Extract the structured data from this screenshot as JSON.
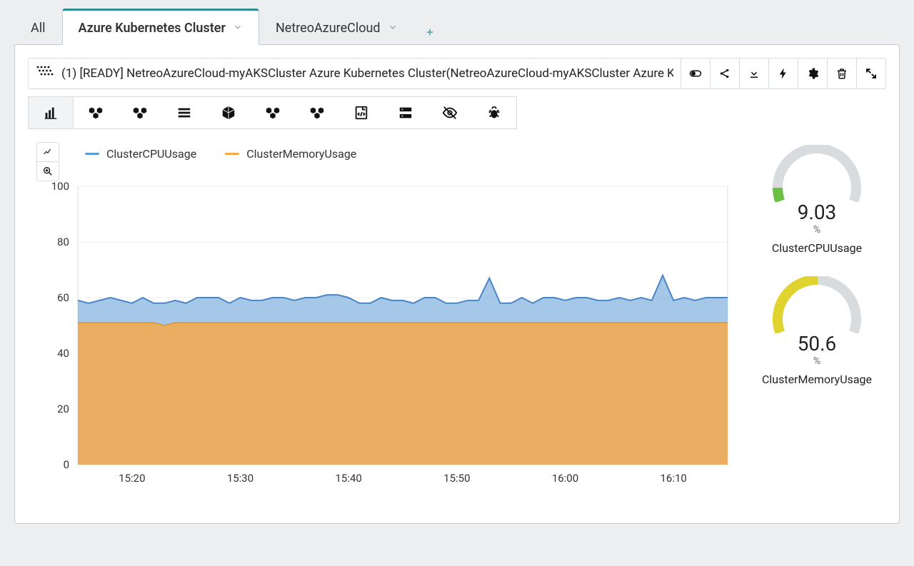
{
  "tabs": {
    "all": "All",
    "active": "Azure Kubernetes Cluster",
    "second": "NetreoAzureCloud"
  },
  "header": {
    "title": "(1) [READY] NetreoAzureCloud-myAKSCluster Azure Kubernetes Cluster(NetreoAzureCloud-myAKSCluster Azure K"
  },
  "legend": {
    "s1": "ClusterCPUUsage",
    "s2": "ClusterMemoryUsage"
  },
  "gauges": [
    {
      "value": "9.03",
      "unit": "%",
      "label": "ClusterCPUUsage",
      "pct": 9.03,
      "color": "#6dbf46"
    },
    {
      "value": "50.6",
      "unit": "%",
      "label": "ClusterMemoryUsage",
      "pct": 50.6,
      "color": "#e0d32f"
    }
  ],
  "chart_data": {
    "type": "area",
    "ylim": [
      0,
      100
    ],
    "yticks": [
      0,
      20,
      40,
      60,
      80,
      100
    ],
    "xticks": [
      "15:20",
      "15:30",
      "15:40",
      "15:50",
      "16:00",
      "16:10"
    ],
    "x": [
      "15:15",
      "15:16",
      "15:17",
      "15:18",
      "15:19",
      "15:20",
      "15:21",
      "15:22",
      "15:23",
      "15:24",
      "15:25",
      "15:26",
      "15:27",
      "15:28",
      "15:29",
      "15:30",
      "15:31",
      "15:32",
      "15:33",
      "15:34",
      "15:35",
      "15:36",
      "15:37",
      "15:38",
      "15:39",
      "15:40",
      "15:41",
      "15:42",
      "15:43",
      "15:44",
      "15:45",
      "15:46",
      "15:47",
      "15:48",
      "15:49",
      "15:50",
      "15:51",
      "15:52",
      "15:53",
      "15:54",
      "15:55",
      "15:56",
      "15:57",
      "15:58",
      "15:59",
      "16:00",
      "16:01",
      "16:02",
      "16:03",
      "16:04",
      "16:05",
      "16:06",
      "16:07",
      "16:08",
      "16:09",
      "16:10",
      "16:11",
      "16:12",
      "16:13",
      "16:14",
      "16:15"
    ],
    "series": [
      {
        "name": "ClusterMemoryUsage",
        "color": "#f6a94b",
        "values": [
          51,
          51,
          51,
          51,
          51,
          51,
          51,
          51,
          50,
          51,
          51,
          51,
          51,
          51,
          51,
          51,
          51,
          51,
          51,
          51,
          51,
          51,
          51,
          51,
          51,
          51,
          51,
          51,
          51,
          51,
          51,
          51,
          51,
          51,
          51,
          51,
          51,
          51,
          51,
          51,
          51,
          51,
          51,
          51,
          51,
          51,
          51,
          51,
          51,
          51,
          51,
          51,
          51,
          51,
          51,
          51,
          51,
          51,
          51,
          51,
          51
        ]
      },
      {
        "name": "ClusterCPUUsage",
        "color": "#5b9bd5",
        "values": [
          59,
          58,
          59,
          60,
          59,
          58,
          60,
          58,
          58,
          59,
          58,
          60,
          60,
          60,
          58,
          60,
          59,
          59,
          60,
          60,
          59,
          60,
          60,
          61,
          61,
          60,
          58,
          58,
          60,
          59,
          59,
          58,
          60,
          60,
          58,
          58,
          59,
          59,
          67,
          58,
          58,
          60,
          58,
          60,
          60,
          59,
          60,
          60,
          59,
          59,
          60,
          59,
          60,
          59,
          68,
          59,
          60,
          59,
          60,
          60,
          60
        ]
      }
    ]
  }
}
